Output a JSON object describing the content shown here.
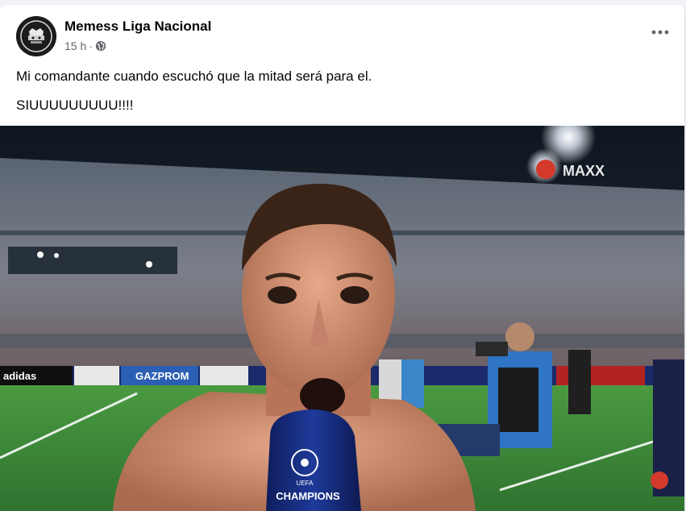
{
  "post": {
    "page_name": "Memess Liga Nacional",
    "time_ago": "15 h",
    "separator": "·",
    "privacy_icon": "globe-icon",
    "more_icon": "more-options-icon",
    "text_line_1": "Mi comandante cuando escuchó que la mitad será para el.",
    "text_line_2": "SIUUUUUUUUU!!!!"
  },
  "media": {
    "broadcaster_logo_text": "MAXX",
    "board_sponsor_1": "adidas",
    "board_sponsor_2": "GAZPROM",
    "mic_text": "CHAMPIONS",
    "mic_subtext": "UEFA"
  },
  "colors": {
    "text_primary": "#050505",
    "text_secondary": "#65676b",
    "page_background": "#f0f2f5",
    "card_background": "#ffffff",
    "pitch_green": "#3f8a3a",
    "mic_blue": "#14287a"
  }
}
